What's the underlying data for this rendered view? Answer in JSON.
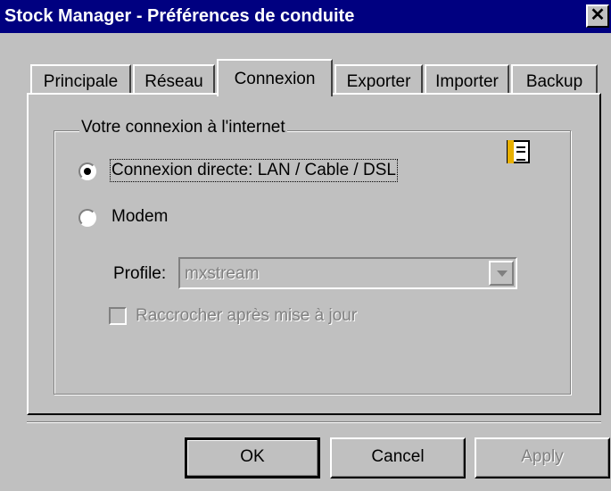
{
  "window": {
    "title": "Stock Manager - Préférences de conduite",
    "close_glyph": "✕"
  },
  "tabs": [
    {
      "label": "Principale",
      "active": false
    },
    {
      "label": "Réseau",
      "active": false
    },
    {
      "label": "Connexion",
      "active": true
    },
    {
      "label": "Exporter",
      "active": false
    },
    {
      "label": "Importer",
      "active": false
    },
    {
      "label": "Backup",
      "active": false
    }
  ],
  "connection": {
    "group_label": "Votre connexion à l'internet",
    "options": [
      {
        "label": "Connexion directe: LAN / Cable / DSL",
        "selected": true
      },
      {
        "label": "Modem",
        "selected": false
      }
    ],
    "profile_label": "Profile:",
    "profile_value": "mxstream",
    "hangup_label": "Raccrocher après mise à jour",
    "hangup_checked": false,
    "help_icon": "info-book-icon"
  },
  "buttons": {
    "ok": "OK",
    "cancel": "Cancel",
    "apply": "Apply"
  },
  "colors": {
    "titlebar": "#000080",
    "face": "#c0c0c0",
    "disabled_text": "#808080"
  }
}
